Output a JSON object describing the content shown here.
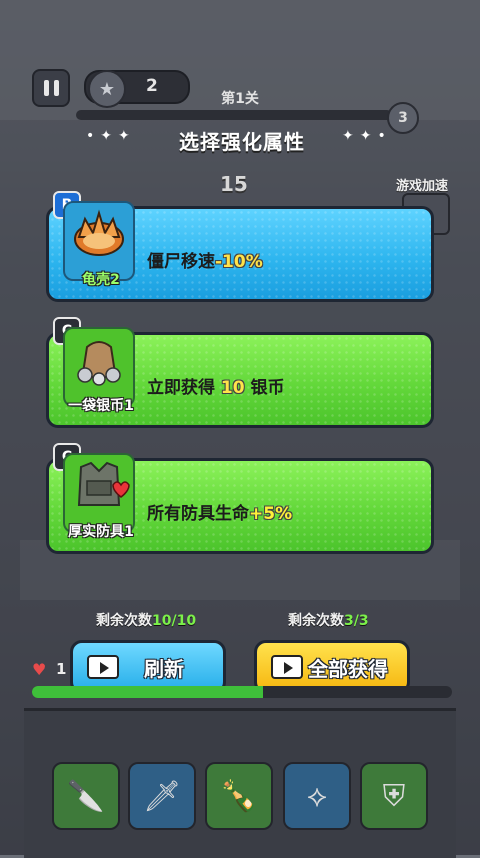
{
  "hud": {
    "coin_count": "2",
    "level_label": "第1关",
    "level_badge": "3",
    "timer": "15",
    "speed_label": "游戏加速"
  },
  "title": "选择强化属性",
  "cards": [
    {
      "rarity": "B",
      "name": "龟壳2",
      "desc_text": "僵尸移速",
      "desc_value": "-10%",
      "desc_suffix": "",
      "color": "#2eb6ef",
      "icon": "turtle-shell-icon"
    },
    {
      "rarity": "C",
      "name": "一袋银币1",
      "desc_text": "立即获得",
      "desc_value": "10",
      "desc_suffix": "银币",
      "color": "#63d83a",
      "icon": "silver-coin-bag-icon"
    },
    {
      "rarity": "C",
      "name": "厚实防具1",
      "desc_text": "所有防具生命",
      "desc_value": "+5%",
      "desc_suffix": "",
      "color": "#63d83a",
      "icon": "armor-vest-icon"
    }
  ],
  "remaining": {
    "refresh_label": "剩余次数",
    "refresh_count": "10/10",
    "getall_label": "剩余次数",
    "getall_count": "3/3"
  },
  "buttons": {
    "refresh": "刷新",
    "get_all": "全部获得"
  },
  "player": {
    "hp": "1",
    "xp_progress": 0.55
  },
  "weapon_slots": [
    {
      "icon": "knife-icon"
    },
    {
      "icon": "kunai-icon"
    },
    {
      "icon": "molotov-icon"
    },
    {
      "icon": "boomerang-icon"
    },
    {
      "icon": "armor-icon"
    }
  ]
}
